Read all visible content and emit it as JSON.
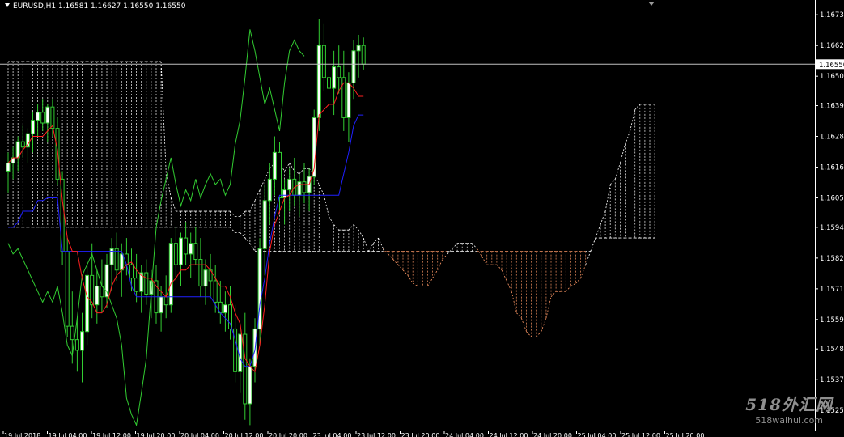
{
  "window": {
    "title": "EURUSD,H1  1.16581 1.16627 1.16550 1.16550",
    "current_price_label": "1.16550"
  },
  "watermark": {
    "line1": "518外汇网",
    "line2": "518waihui.com"
  },
  "colors": {
    "background": "#000000",
    "bull_candle": "#ffffff",
    "wick": "#32cd32",
    "bear_candle": "#000000",
    "tenkan": "#ff2020",
    "kijun": "#2020ff",
    "chikou": "#32cd32",
    "cloud_a": "#ffffff",
    "cloud_b": "#ff9966",
    "price_line": "#c0c0c0",
    "axis_text": "#ffffff"
  },
  "chart_data": {
    "type": "candlestick",
    "symbol": "EURUSD",
    "timeframe": "H1",
    "ylim": [
      1.1518,
      1.1679
    ],
    "y_ticks": [
      1.16735,
      1.1662,
      1.16505,
      1.16395,
      1.1628,
      1.16165,
      1.1605,
      1.1594,
      1.15825,
      1.1571,
      1.15595,
      1.15485,
      1.1537,
      1.15255
    ],
    "y_tick_labels": [
      "1.16735",
      "1.16620",
      "1.16505",
      "1.16395",
      "1.16280",
      "1.16165",
      "1.16050",
      "1.15940",
      "1.15825",
      "1.15710",
      "1.15595",
      "1.15485",
      "1.15370",
      "1.15255"
    ],
    "current_price": 1.1655,
    "x_tick_labels": [
      "19 Jul 2018",
      "19 Jul 04:00",
      "19 Jul 12:00",
      "19 Jul 20:00",
      "20 Jul 04:00",
      "20 Jul 12:00",
      "20 Jul 20:00",
      "23 Jul 04:00",
      "23 Jul 12:00",
      "23 Jul 20:00",
      "24 Jul 04:00",
      "24 Jul 12:00",
      "24 Jul 20:00",
      "25 Jul 04:00",
      "25 Jul 12:00",
      "25 Jul 20:00"
    ],
    "candles": [
      {
        "o": 1.1615,
        "h": 1.1622,
        "l": 1.1607,
        "c": 1.1618
      },
      {
        "o": 1.1618,
        "h": 1.1624,
        "l": 1.1612,
        "c": 1.162
      },
      {
        "o": 1.162,
        "h": 1.1628,
        "l": 1.1615,
        "c": 1.1626
      },
      {
        "o": 1.1626,
        "h": 1.1632,
        "l": 1.162,
        "c": 1.1624
      },
      {
        "o": 1.1624,
        "h": 1.1631,
        "l": 1.1618,
        "c": 1.1629
      },
      {
        "o": 1.1629,
        "h": 1.1637,
        "l": 1.1622,
        "c": 1.1634
      },
      {
        "o": 1.1634,
        "h": 1.164,
        "l": 1.1628,
        "c": 1.1637
      },
      {
        "o": 1.1637,
        "h": 1.1642,
        "l": 1.163,
        "c": 1.1633
      },
      {
        "o": 1.1633,
        "h": 1.164,
        "l": 1.1626,
        "c": 1.1639
      },
      {
        "o": 1.1639,
        "h": 1.1642,
        "l": 1.1628,
        "c": 1.1631
      },
      {
        "o": 1.1631,
        "h": 1.1635,
        "l": 1.161,
        "c": 1.1612
      },
      {
        "o": 1.1612,
        "h": 1.1615,
        "l": 1.158,
        "c": 1.1585
      },
      {
        "o": 1.1585,
        "h": 1.159,
        "l": 1.1553,
        "c": 1.1557
      },
      {
        "o": 1.1557,
        "h": 1.157,
        "l": 1.1543,
        "c": 1.1552
      },
      {
        "o": 1.1552,
        "h": 1.156,
        "l": 1.154,
        "c": 1.1548
      },
      {
        "o": 1.1548,
        "h": 1.1562,
        "l": 1.1536,
        "c": 1.1555
      },
      {
        "o": 1.1555,
        "h": 1.158,
        "l": 1.155,
        "c": 1.1576
      },
      {
        "o": 1.1576,
        "h": 1.1588,
        "l": 1.156,
        "c": 1.1565
      },
      {
        "o": 1.1565,
        "h": 1.1578,
        "l": 1.1558,
        "c": 1.1572
      },
      {
        "o": 1.1572,
        "h": 1.1582,
        "l": 1.1562,
        "c": 1.1568
      },
      {
        "o": 1.1568,
        "h": 1.1584,
        "l": 1.1564,
        "c": 1.158
      },
      {
        "o": 1.158,
        "h": 1.159,
        "l": 1.157,
        "c": 1.1586
      },
      {
        "o": 1.1586,
        "h": 1.1592,
        "l": 1.1574,
        "c": 1.1578
      },
      {
        "o": 1.1578,
        "h": 1.1588,
        "l": 1.1568,
        "c": 1.1584
      },
      {
        "o": 1.1584,
        "h": 1.159,
        "l": 1.1576,
        "c": 1.158
      },
      {
        "o": 1.158,
        "h": 1.1586,
        "l": 1.157,
        "c": 1.1575
      },
      {
        "o": 1.1575,
        "h": 1.1584,
        "l": 1.1566,
        "c": 1.157
      },
      {
        "o": 1.157,
        "h": 1.158,
        "l": 1.1562,
        "c": 1.1577
      },
      {
        "o": 1.1577,
        "h": 1.1582,
        "l": 1.1565,
        "c": 1.1569
      },
      {
        "o": 1.1569,
        "h": 1.1578,
        "l": 1.156,
        "c": 1.1574
      },
      {
        "o": 1.1574,
        "h": 1.158,
        "l": 1.1558,
        "c": 1.1562
      },
      {
        "o": 1.1562,
        "h": 1.1572,
        "l": 1.1555,
        "c": 1.1568
      },
      {
        "o": 1.1568,
        "h": 1.1576,
        "l": 1.156,
        "c": 1.1565
      },
      {
        "o": 1.1565,
        "h": 1.159,
        "l": 1.1562,
        "c": 1.1588
      },
      {
        "o": 1.1588,
        "h": 1.1594,
        "l": 1.1574,
        "c": 1.158
      },
      {
        "o": 1.158,
        "h": 1.1592,
        "l": 1.1572,
        "c": 1.159
      },
      {
        "o": 1.159,
        "h": 1.1596,
        "l": 1.158,
        "c": 1.1584
      },
      {
        "o": 1.1584,
        "h": 1.1592,
        "l": 1.1575,
        "c": 1.1588
      },
      {
        "o": 1.1588,
        "h": 1.1594,
        "l": 1.158,
        "c": 1.1582
      },
      {
        "o": 1.1582,
        "h": 1.159,
        "l": 1.1568,
        "c": 1.1572
      },
      {
        "o": 1.1572,
        "h": 1.1582,
        "l": 1.1565,
        "c": 1.1578
      },
      {
        "o": 1.1578,
        "h": 1.1584,
        "l": 1.1568,
        "c": 1.1574
      },
      {
        "o": 1.1574,
        "h": 1.158,
        "l": 1.1562,
        "c": 1.1566
      },
      {
        "o": 1.1566,
        "h": 1.1574,
        "l": 1.1558,
        "c": 1.1562
      },
      {
        "o": 1.1562,
        "h": 1.157,
        "l": 1.1555,
        "c": 1.1565
      },
      {
        "o": 1.1565,
        "h": 1.1572,
        "l": 1.1552,
        "c": 1.1556
      },
      {
        "o": 1.1556,
        "h": 1.1565,
        "l": 1.1536,
        "c": 1.154
      },
      {
        "o": 1.154,
        "h": 1.1558,
        "l": 1.1532,
        "c": 1.1554
      },
      {
        "o": 1.1554,
        "h": 1.1562,
        "l": 1.1522,
        "c": 1.1528
      },
      {
        "o": 1.1528,
        "h": 1.1545,
        "l": 1.152,
        "c": 1.1542
      },
      {
        "o": 1.1542,
        "h": 1.156,
        "l": 1.1536,
        "c": 1.1556
      },
      {
        "o": 1.1556,
        "h": 1.159,
        "l": 1.155,
        "c": 1.1586
      },
      {
        "o": 1.1586,
        "h": 1.161,
        "l": 1.1576,
        "c": 1.1604
      },
      {
        "o": 1.1604,
        "h": 1.1618,
        "l": 1.1595,
        "c": 1.1612
      },
      {
        "o": 1.1612,
        "h": 1.1628,
        "l": 1.1606,
        "c": 1.1622
      },
      {
        "o": 1.1622,
        "h": 1.1626,
        "l": 1.16,
        "c": 1.1605
      },
      {
        "o": 1.1605,
        "h": 1.1612,
        "l": 1.1595,
        "c": 1.1608
      },
      {
        "o": 1.1608,
        "h": 1.1616,
        "l": 1.16,
        "c": 1.1612
      },
      {
        "o": 1.1612,
        "h": 1.162,
        "l": 1.1602,
        "c": 1.1606
      },
      {
        "o": 1.1606,
        "h": 1.1614,
        "l": 1.1598,
        "c": 1.1611
      },
      {
        "o": 1.1611,
        "h": 1.1618,
        "l": 1.1603,
        "c": 1.1607
      },
      {
        "o": 1.1607,
        "h": 1.1616,
        "l": 1.16,
        "c": 1.1613
      },
      {
        "o": 1.1613,
        "h": 1.1638,
        "l": 1.161,
        "c": 1.1635
      },
      {
        "o": 1.1635,
        "h": 1.1672,
        "l": 1.163,
        "c": 1.1662
      },
      {
        "o": 1.1662,
        "h": 1.167,
        "l": 1.1645,
        "c": 1.165
      },
      {
        "o": 1.165,
        "h": 1.1674,
        "l": 1.164,
        "c": 1.1646
      },
      {
        "o": 1.1646,
        "h": 1.166,
        "l": 1.1636,
        "c": 1.1654
      },
      {
        "o": 1.1654,
        "h": 1.1662,
        "l": 1.1644,
        "c": 1.165
      },
      {
        "o": 1.165,
        "h": 1.166,
        "l": 1.163,
        "c": 1.1635
      },
      {
        "o": 1.1635,
        "h": 1.1652,
        "l": 1.1626,
        "c": 1.1648
      },
      {
        "o": 1.1648,
        "h": 1.1664,
        "l": 1.1642,
        "c": 1.166
      },
      {
        "o": 1.166,
        "h": 1.1666,
        "l": 1.165,
        "c": 1.1662
      },
      {
        "o": 1.1662,
        "h": 1.1665,
        "l": 1.1653,
        "c": 1.1655
      }
    ],
    "series": [
      {
        "name": "Tenkan-sen",
        "values": [
          1.1618,
          1.162,
          1.162,
          1.1623,
          1.1625,
          1.1628,
          1.1628,
          1.1628,
          1.163,
          1.1632,
          1.1623,
          1.1604,
          1.159,
          1.1585,
          1.1585,
          1.1575,
          1.1568,
          1.1566,
          1.1562,
          1.1562,
          1.1565,
          1.1572,
          1.1576,
          1.1578,
          1.158,
          1.1581,
          1.1578,
          1.1576,
          1.1575,
          1.1575,
          1.1572,
          1.157,
          1.1568,
          1.1573,
          1.1575,
          1.1578,
          1.1578,
          1.158,
          1.158,
          1.158,
          1.158,
          1.1578,
          1.1575,
          1.1572,
          1.1572,
          1.1568,
          1.1562,
          1.1558,
          1.1545,
          1.1542,
          1.154,
          1.155,
          1.1565,
          1.1585,
          1.1595,
          1.16,
          1.1605,
          1.1606,
          1.1609,
          1.161,
          1.161,
          1.161,
          1.1616,
          1.1636,
          1.1638,
          1.164,
          1.164,
          1.1645,
          1.1648,
          1.1648,
          1.1646,
          1.1643,
          1.1643
        ]
      },
      {
        "name": "Kijun-sen",
        "values": [
          1.1594,
          1.1594,
          1.1596,
          1.16,
          1.16,
          1.16,
          1.1604,
          1.1604,
          1.1605,
          1.1605,
          1.1605,
          1.1585,
          1.1585,
          1.1585,
          1.1585,
          1.1585,
          1.1585,
          1.1585,
          1.1585,
          1.1585,
          1.1585,
          1.1585,
          1.1585,
          1.1585,
          1.158,
          1.1572,
          1.1568,
          1.1568,
          1.1568,
          1.1568,
          1.1568,
          1.1568,
          1.1568,
          1.1568,
          1.1568,
          1.1568,
          1.1568,
          1.1568,
          1.1568,
          1.1568,
          1.1568,
          1.1568,
          1.1565,
          1.1562,
          1.156,
          1.1558,
          1.1552,
          1.1545,
          1.1542,
          1.1542,
          1.1548,
          1.1565,
          1.1575,
          1.1588,
          1.1598,
          1.1606,
          1.1606,
          1.1606,
          1.1606,
          1.1606,
          1.1606,
          1.1606,
          1.1606,
          1.1606,
          1.1606,
          1.1606,
          1.1606,
          1.1606,
          1.1614,
          1.1622,
          1.1632,
          1.1636,
          1.1636
        ]
      },
      {
        "name": "Chikou Span",
        "values": [
          1.1588,
          1.1584,
          1.1586,
          1.1582,
          1.1578,
          1.1574,
          1.157,
          1.1566,
          1.157,
          1.1566,
          1.1572,
          1.1562,
          1.155,
          1.1546,
          1.156,
          1.1576,
          1.158,
          1.1584,
          1.1578,
          1.1572,
          1.157,
          1.1565,
          1.156,
          1.155,
          1.153,
          1.1524,
          1.152,
          1.1532,
          1.1545,
          1.157,
          1.1594,
          1.1604,
          1.1612,
          1.162,
          1.161,
          1.1602,
          1.1608,
          1.1604,
          1.1612,
          1.1605,
          1.161,
          1.1614,
          1.161,
          1.1612,
          1.1606,
          1.161,
          1.1625,
          1.1634,
          1.165,
          1.1668,
          1.166,
          1.165,
          1.164,
          1.1646,
          1.1638,
          1.163,
          1.1648,
          1.166,
          1.1664,
          1.166,
          1.1658
        ]
      },
      {
        "name": "Senkou Span A",
        "values": [
          1.1656,
          1.1656,
          1.1656,
          1.1656,
          1.1656,
          1.1656,
          1.1656,
          1.1656,
          1.1656,
          1.1656,
          1.1656,
          1.1656,
          1.1656,
          1.1656,
          1.1656,
          1.1656,
          1.1656,
          1.1656,
          1.1656,
          1.1656,
          1.1656,
          1.1656,
          1.1656,
          1.1656,
          1.1656,
          1.1656,
          1.1656,
          1.1656,
          1.1656,
          1.1656,
          1.1656,
          1.1656,
          1.1615,
          1.1605,
          1.16,
          1.16,
          1.16,
          1.16,
          1.16,
          1.16,
          1.16,
          1.16,
          1.16,
          1.16,
          1.16,
          1.16,
          1.1598,
          1.1598,
          1.16,
          1.16,
          1.1604,
          1.1608,
          1.1612,
          1.1616,
          1.1618,
          1.1618,
          1.1615,
          1.1618,
          1.1615,
          1.1614,
          1.1616,
          1.1616,
          1.1614,
          1.161,
          1.1606,
          1.1598,
          1.1595,
          1.1593,
          1.1593,
          1.1593,
          1.1595,
          1.1593,
          1.159,
          1.1585,
          1.1588,
          1.159,
          1.1586,
          1.1584,
          1.1582,
          1.158,
          1.1578,
          1.1576,
          1.1573,
          1.1572,
          1.1572,
          1.1572,
          1.1575,
          1.1578,
          1.1582,
          1.1584,
          1.1586,
          1.1588,
          1.1588,
          1.1588,
          1.1588,
          1.1586,
          1.1583,
          1.158,
          1.158,
          1.158,
          1.1578,
          1.1574,
          1.157,
          1.1562,
          1.156,
          1.1555,
          1.1553,
          1.1553,
          1.1555,
          1.156,
          1.1568,
          1.157,
          1.157,
          1.157,
          1.1572,
          1.1573,
          1.1575,
          1.158,
          1.1585,
          1.159,
          1.1595,
          1.16,
          1.161,
          1.1612,
          1.1618,
          1.1625,
          1.163,
          1.1638,
          1.164,
          1.164,
          1.164,
          1.164
        ]
      },
      {
        "name": "Senkou Span B",
        "values": [
          1.1594,
          1.1594,
          1.1594,
          1.1594,
          1.1594,
          1.1594,
          1.1594,
          1.1594,
          1.1594,
          1.1594,
          1.1594,
          1.1594,
          1.1594,
          1.1594,
          1.1594,
          1.1594,
          1.1594,
          1.1594,
          1.1594,
          1.1594,
          1.1594,
          1.1594,
          1.1594,
          1.1594,
          1.1594,
          1.1594,
          1.1594,
          1.1594,
          1.1594,
          1.1594,
          1.1594,
          1.1594,
          1.1594,
          1.1594,
          1.1594,
          1.1594,
          1.1594,
          1.1594,
          1.1594,
          1.1594,
          1.1594,
          1.1594,
          1.1594,
          1.1594,
          1.1594,
          1.1594,
          1.1592,
          1.1592,
          1.159,
          1.1588,
          1.1585,
          1.1585,
          1.1585,
          1.1585,
          1.1585,
          1.1585,
          1.1585,
          1.1585,
          1.1585,
          1.1585,
          1.1585,
          1.1585,
          1.1585,
          1.1585,
          1.1585,
          1.1585,
          1.1585,
          1.1585,
          1.1585,
          1.1585,
          1.1585,
          1.1585,
          1.1585,
          1.1585,
          1.1585,
          1.1585,
          1.1585,
          1.1585,
          1.1585,
          1.1585,
          1.1585,
          1.1585,
          1.1585,
          1.1585,
          1.1585,
          1.1585,
          1.1585,
          1.1585,
          1.1585,
          1.1585,
          1.1585,
          1.1585,
          1.1585,
          1.1585,
          1.1585,
          1.1585,
          1.1585,
          1.1585,
          1.1585,
          1.1585,
          1.1585,
          1.1585,
          1.1585,
          1.1585,
          1.1585,
          1.1585,
          1.1585,
          1.1585,
          1.1585,
          1.1585,
          1.1585,
          1.1585,
          1.1585,
          1.1585,
          1.1585,
          1.1585,
          1.1585,
          1.1585,
          1.1585,
          1.159,
          1.159,
          1.159,
          1.159,
          1.159,
          1.159,
          1.159,
          1.159,
          1.159,
          1.159,
          1.159,
          1.159,
          1.159,
          1.159
        ]
      }
    ],
    "grid": false,
    "legend": "none"
  }
}
